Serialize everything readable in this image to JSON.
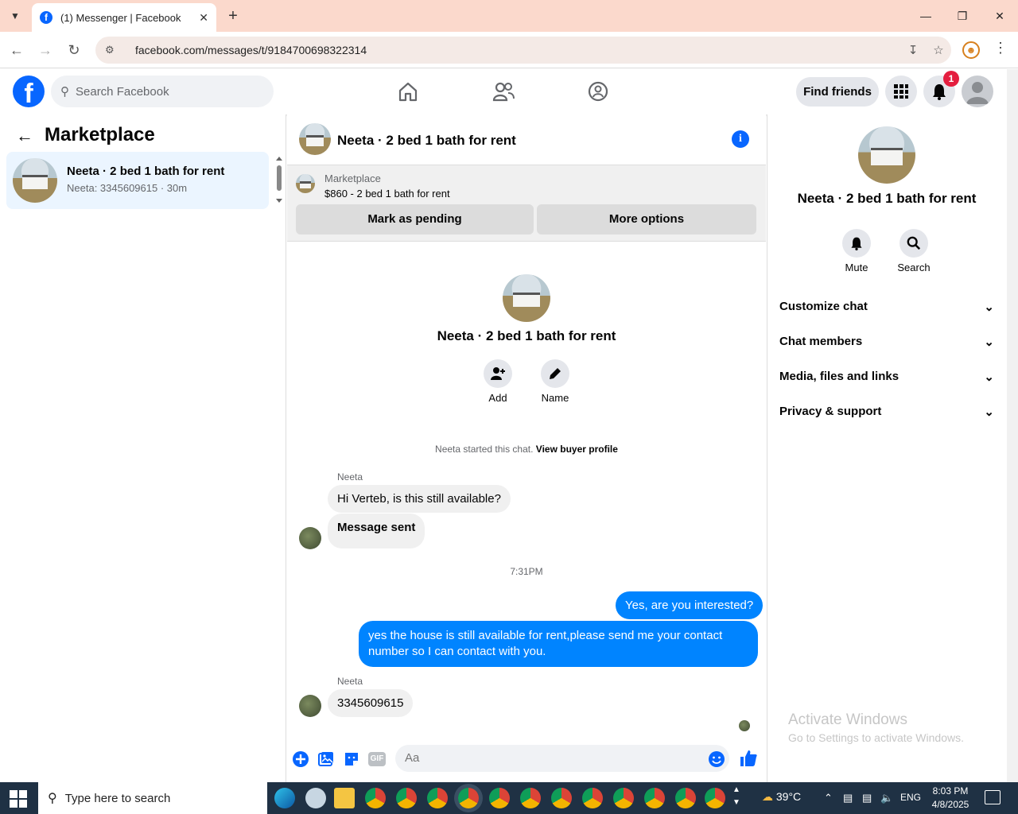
{
  "browser": {
    "tab_title": "(1) Messenger | Facebook",
    "url": "facebook.com/messages/t/9184700698322314"
  },
  "fb": {
    "search_placeholder": "Search Facebook",
    "find_friends": "Find friends",
    "notif_count": "1"
  },
  "left": {
    "title": "Marketplace",
    "conversations": [
      {
        "name": "Neeta · 2 bed 1 bath for rent",
        "preview": "Neeta: 3345609615 · 30m"
      }
    ]
  },
  "chat": {
    "title": "Neeta · 2 bed 1 bath for rent",
    "listing_source": "Marketplace",
    "listing_price_title": "$860 - 2 bed 1 bath for rent",
    "mark_pending": "Mark as pending",
    "more_options": "More options",
    "profile_name": "Neeta · 2 bed 1 bath for rent",
    "actions": [
      {
        "label": "Add"
      },
      {
        "label": "Name"
      }
    ],
    "started_text": "Neeta started this chat.",
    "view_buyer": "View buyer profile",
    "timestamp": "7:31PM",
    "messages": [
      {
        "sender": "Neeta",
        "text": "Hi Verteb, is this still available?"
      },
      {
        "text": "Message sent"
      },
      {
        "text": "Yes, are you interested?"
      },
      {
        "text": "yes the house is still available for rent,please send me your contact number so I can contact with you."
      },
      {
        "sender": "Neeta",
        "text": "3345609615"
      }
    ],
    "composer_placeholder": "Aa",
    "composer_icons": [
      "plus-icon",
      "photo-icon",
      "sticker-icon",
      "gif-icon",
      "emoji-icon",
      "like-icon"
    ]
  },
  "right": {
    "name": "Neeta · 2 bed 1 bath for rent",
    "mute": "Mute",
    "search": "Search",
    "sections": [
      "Customize chat",
      "Chat members",
      "Media, files and links",
      "Privacy & support"
    ],
    "activate_title": "Activate Windows",
    "activate_sub": "Go to Settings to activate Windows."
  },
  "taskbar": {
    "search_placeholder": "Type here to search",
    "weather": "39°C",
    "lang": "ENG",
    "time": "8:03 PM",
    "date": "4/8/2025"
  },
  "colors": {
    "brand": "#0866ff",
    "outgoing": "#0084ff",
    "badge": "#e41e3f",
    "taskbar": "#1f3144"
  }
}
